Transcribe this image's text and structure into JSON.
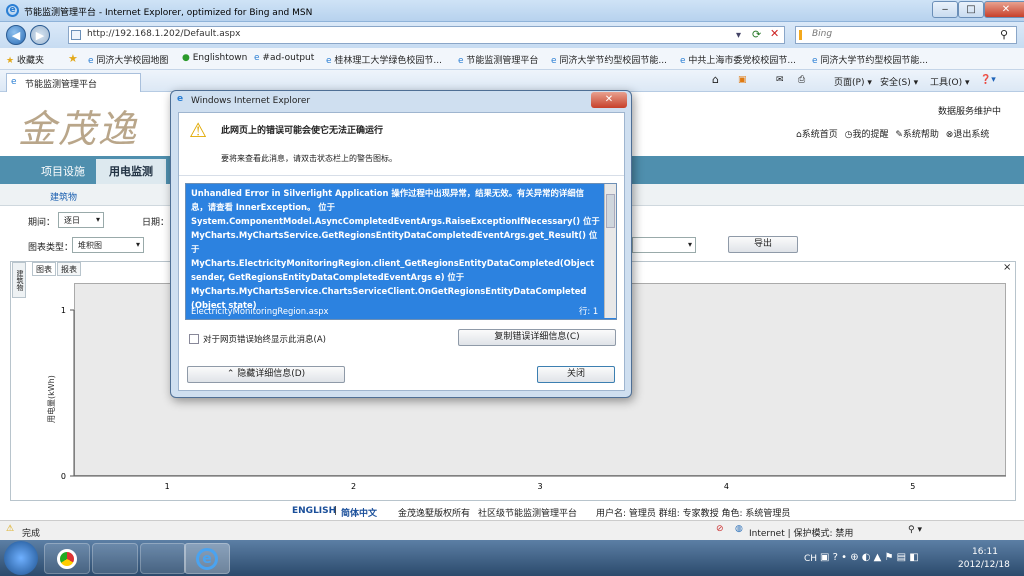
{
  "window": {
    "title": "节能监测管理平台 - Internet Explorer, optimized for Bing and MSN"
  },
  "addressbar": {
    "url": "http://192.168.1.202/Default.aspx",
    "search_placeholder": "Bing"
  },
  "favorites": {
    "label": "收藏夹",
    "items": [
      "同济大学校园地图",
      "Englishtown",
      "#ad-output",
      "桂林理工大学绿色校园节...",
      "节能监测管理平台",
      "同济大学节约型校园节能...",
      "中共上海市委党校校园节...",
      "同济大学节约型校园节能..."
    ]
  },
  "tab": {
    "title": "节能监测管理平台"
  },
  "commandbar": {
    "page": "页面(P)",
    "safety": "安全(S)",
    "tools": "工具(O)"
  },
  "site": {
    "logo_text": "金茂逸",
    "top_right": "数据服务维护中",
    "links": [
      "系统首页",
      "我的提醒",
      "系统帮助",
      "退出系统"
    ],
    "nav": [
      "项目设施",
      "用电监测"
    ],
    "breadcrumb": "建筑物",
    "filters": {
      "period_label": "期间：",
      "period_value": "逐日",
      "date_label": "日期：",
      "chart_type_label": "图表类型：",
      "chart_type_value": "堆积图"
    },
    "export_label": "导出",
    "side_tab": "建筑物",
    "chart_tabs": [
      "图表",
      "报表"
    ],
    "close": "×"
  },
  "chart_data": {
    "type": "bar",
    "categories": [
      "1",
      "2",
      "3",
      "4",
      "5"
    ],
    "series": [],
    "ylabel": "用电量(kWh)",
    "xlabel": "",
    "ylim": [
      0,
      1
    ],
    "yticks": [
      "0",
      "1"
    ],
    "grid": false
  },
  "footer": {
    "english": "ENGLISH",
    "sep": "|",
    "chinese": "简体中文",
    "copyright": "金茂逸墅版权所有",
    "platform": "社区级节能监测管理平台",
    "user": "用户名: 管理员 群组: 专家教授 角色: 系统管理员"
  },
  "status": {
    "left": "完成",
    "zone": "Internet | 保护模式: 禁用",
    "zoom": ""
  },
  "taskbar": {
    "lang": "CH",
    "time": "16:11",
    "date": "2012/12/18"
  },
  "dialog": {
    "title": "Windows Internet Explorer",
    "heading": "此网页上的错误可能会使它无法正确运行",
    "subtext": "要将来查看此消息，请双击状态栏上的警告图标。",
    "error": "Unhandled Error in Silverlight Application 操作过程中出现异常，结果无效。有关异常的详细信息，请查看 InnerException。 位于 System.ComponentModel.AsyncCompletedEventArgs.RaiseExceptionIfNecessary() 位于 MyCharts.MyChartsService.GetRegionsEntityDataCompletedEventArgs.get_Result() 位于 MyCharts.ElectricityMonitoringRegion.client_GetRegionsEntityDataCompleted(Object sender, GetRegionsEntityDataCompletedEventArgs e) 位于 MyCharts.MyChartsService.ChartsServiceClient.OnGetRegionsEntityDataCompleted (Object state)",
    "file": "ElectricityMonitoringRegion.aspx",
    "line": "行: 1",
    "checkbox_label": "对于网页错误始终显示此消息(A)",
    "copy_button": "复制错误详细信息(C)",
    "hide_button": "隐藏详细信息(D)",
    "close_button": "关闭"
  }
}
